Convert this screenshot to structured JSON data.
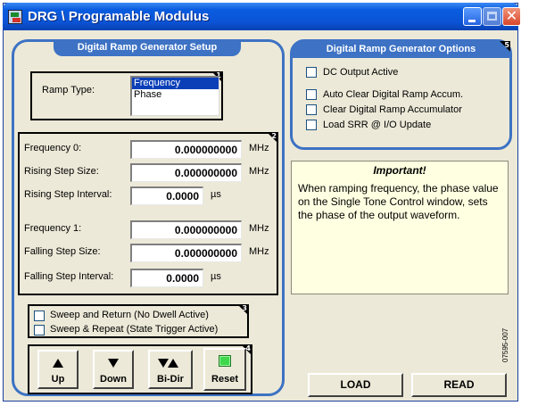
{
  "window": {
    "title": "DRG \\ Programable Modulus"
  },
  "setup": {
    "title": "Digital Ramp Generator Setup",
    "ramp_type_label": "Ramp Type:",
    "ramp_options": [
      "Frequency",
      "Phase"
    ],
    "ramp_selected": "Frequency",
    "badges": [
      "1",
      "2",
      "3",
      "4"
    ],
    "params": [
      {
        "label": "Frequency 0:",
        "value": "0.000000000",
        "unit": "MHz"
      },
      {
        "label": "Rising Step Size:",
        "value": "0.000000000",
        "unit": "MHz"
      },
      {
        "label": "Rising Step Interval:",
        "value": "0.0000",
        "unit": "µs"
      },
      {
        "label": "Frequency 1:",
        "value": "0.000000000",
        "unit": "MHz"
      },
      {
        "label": "Falling Step Size:",
        "value": "0.000000000",
        "unit": "MHz"
      },
      {
        "label": "Falling Step Interval:",
        "value": "0.0000",
        "unit": "µs"
      }
    ],
    "sweep_modes": [
      {
        "label": "Sweep and Return (No Dwell Active)",
        "checked": false
      },
      {
        "label": "Sweep & Repeat (State Trigger Active)",
        "checked": false
      }
    ],
    "controls": [
      {
        "label": "Up",
        "icon": "arrow-up-icon"
      },
      {
        "label": "Down",
        "icon": "arrow-down-icon"
      },
      {
        "label": "Bi-Dir",
        "icon": "bidirectional-arrow-icon"
      },
      {
        "label": "Reset",
        "icon": "green-led-icon"
      }
    ]
  },
  "options": {
    "title": "Digital Ramp Generator Options",
    "badge": "5",
    "items": [
      {
        "label": "DC Output Active",
        "checked": false
      },
      {
        "label": "Auto Clear Digital Ramp Accum.",
        "checked": false
      },
      {
        "label": "Clear Digital Ramp Accumulator",
        "checked": false
      },
      {
        "label": "Load SRR @ I/O Update",
        "checked": false
      }
    ]
  },
  "note": {
    "heading": "Important!",
    "text": "When ramping frequency, the phase value on the Single Tone Control window, sets the phase of the output waveform."
  },
  "actions": {
    "load": "LOAD",
    "read": "READ"
  },
  "figure_code": "07595-007",
  "colors": {
    "group_border": "#3d72c4",
    "selection": "#0a3fb8",
    "note_bg": "#ffffe1",
    "led_green": "#3fd84a"
  }
}
